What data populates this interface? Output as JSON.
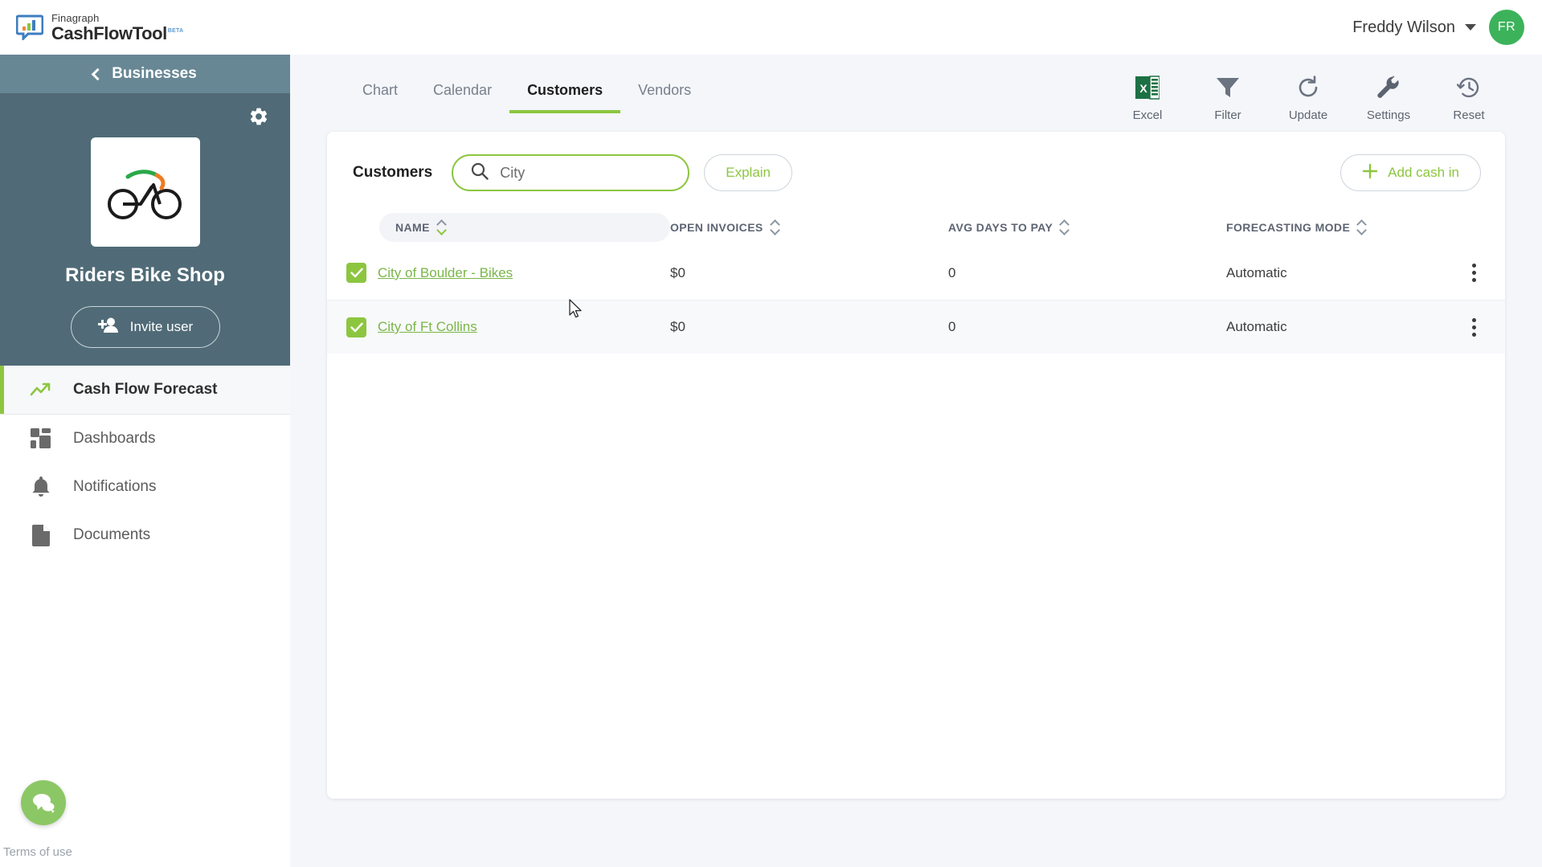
{
  "brand": {
    "top_line": "Finagraph",
    "bottom_line": "CashFlowTool",
    "superscript": "BETA",
    "logo_icon": "chart-bubble-icon"
  },
  "topbar": {
    "user_name": "Freddy Wilson",
    "avatar_initials": "FR",
    "caret_icon": "chevron-down-icon",
    "avatar_color": "#3cb35b"
  },
  "sidebar": {
    "back_label": "Businesses",
    "back_icon": "chevron-left-icon",
    "settings_icon": "gear-icon",
    "business_logo_icon": "bicycle-icon",
    "business_name": "Riders Bike Shop",
    "invite_label": "Invite user",
    "invite_icon": "person-add-icon",
    "panel_color": "#506b77",
    "bar_color": "#688795",
    "items": [
      {
        "label": "Cash Flow Forecast",
        "icon": "trending-up-icon",
        "active": true
      },
      {
        "label": "Dashboards",
        "icon": "dashboard-grid-icon",
        "active": false
      },
      {
        "label": "Notifications",
        "icon": "bell-icon",
        "active": false
      },
      {
        "label": "Documents",
        "icon": "document-icon",
        "active": false
      }
    ],
    "chat_icon": "chat-bubbles-icon",
    "terms_label": "Terms of use",
    "accent_color": "#8cc63f"
  },
  "tabs": [
    {
      "label": "Chart",
      "active": false
    },
    {
      "label": "Calendar",
      "active": false
    },
    {
      "label": "Customers",
      "active": true
    },
    {
      "label": "Vendors",
      "active": false
    }
  ],
  "tools": [
    {
      "label": "Excel",
      "icon": "excel-icon"
    },
    {
      "label": "Filter",
      "icon": "funnel-icon"
    },
    {
      "label": "Update",
      "icon": "refresh-icon"
    },
    {
      "label": "Settings",
      "icon": "wrench-icon"
    },
    {
      "label": "Reset",
      "icon": "history-clock-icon"
    }
  ],
  "panel": {
    "title": "Customers",
    "search": {
      "value": "City",
      "placeholder": "Search",
      "icon": "search-icon"
    },
    "explain_label": "Explain",
    "add_cash_label": "Add cash in",
    "add_cash_icon": "plus-icon"
  },
  "table": {
    "columns": [
      {
        "label": "NAME",
        "sorted": true,
        "sort_dir": "desc"
      },
      {
        "label": "OPEN INVOICES",
        "sorted": false
      },
      {
        "label": "AVG DAYS TO PAY",
        "sorted": false
      },
      {
        "label": "FORECASTING MODE",
        "sorted": false
      }
    ],
    "rows": [
      {
        "checked": true,
        "name": "City of Boulder - Bikes",
        "open_invoices": "$0",
        "avg_days_to_pay": "0",
        "forecasting_mode": "Automatic",
        "menu_icon": "kebab-menu-icon"
      },
      {
        "checked": true,
        "name": "City of Ft Collins",
        "open_invoices": "$0",
        "avg_days_to_pay": "0",
        "forecasting_mode": "Automatic",
        "menu_icon": "kebab-menu-icon"
      }
    ]
  }
}
